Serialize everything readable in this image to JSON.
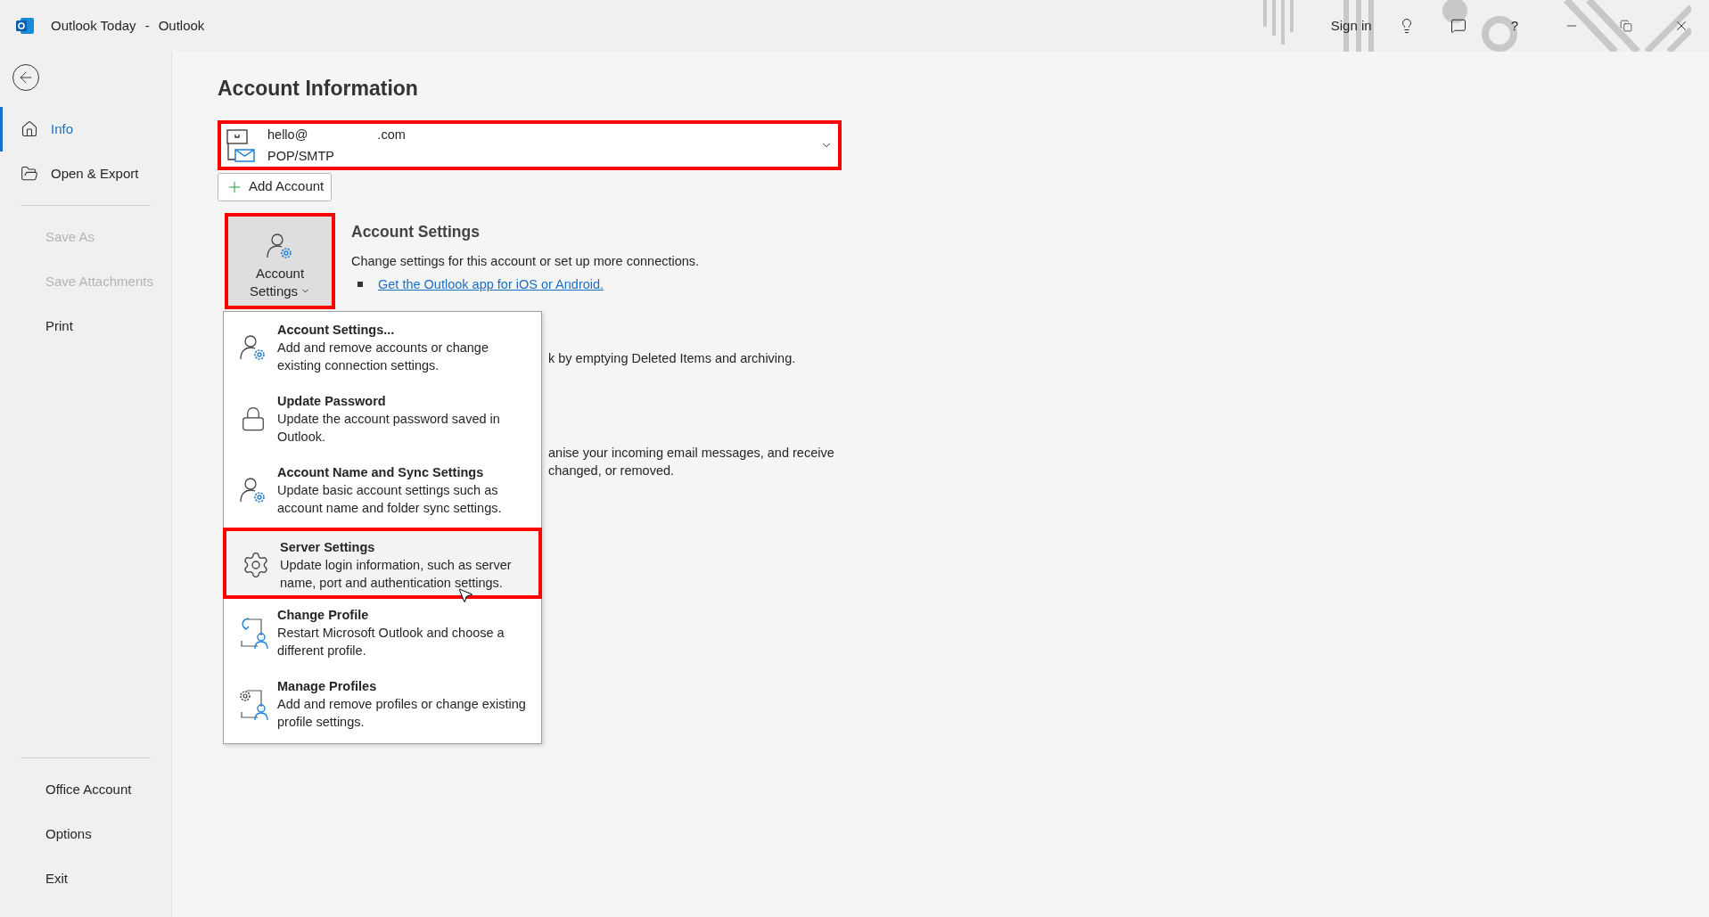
{
  "window": {
    "title": "Outlook Today",
    "separator": "-",
    "app": "Outlook",
    "sign_in": "Sign in",
    "help": "?"
  },
  "sidebar": {
    "top_items": [
      {
        "label": "Info",
        "selected": true
      },
      {
        "label": "Open & Export",
        "selected": false
      }
    ],
    "middle_items": [
      {
        "label": "Save As",
        "disabled": true
      },
      {
        "label": "Save Attachments",
        "disabled": true
      },
      {
        "label": "Print",
        "disabled": false
      }
    ],
    "bottom_items": [
      {
        "label": "Office Account"
      },
      {
        "label": "Options"
      },
      {
        "label": "Exit"
      }
    ]
  },
  "main": {
    "heading": "Account Information",
    "account": {
      "email_start": "hello@",
      "email_end": ".com",
      "type": "POP/SMTP",
      "highlighted": true
    },
    "add_account": "Add Account",
    "account_settings_button": {
      "line1": "Account",
      "line2": "Settings",
      "highlighted": true
    },
    "account_settings_section": {
      "title": "Account Settings",
      "description": "Change settings for this account or set up more connections.",
      "link": "Get the Outlook app for iOS or Android."
    },
    "covered_texts": [
      {
        "lines": [
          "k by emptying Deleted Items and archiving."
        ]
      },
      {
        "lines": [
          "anise your incoming email messages, and receive",
          "changed, or removed."
        ]
      }
    ]
  },
  "menu": {
    "items": [
      {
        "title": "Account Settings...",
        "description": "Add and remove accounts or change existing connection settings.",
        "highlighted": false
      },
      {
        "title": "Update Password",
        "description": "Update the account password saved in Outlook.",
        "highlighted": false
      },
      {
        "title": "Account Name and Sync Settings",
        "description": "Update basic account settings such as account name and folder sync settings.",
        "highlighted": false
      },
      {
        "title": "Server Settings",
        "description": "Update login information, such as server name, port and authentication settings.",
        "highlighted": true
      },
      {
        "title": "Change Profile",
        "description": "Restart Microsoft Outlook and choose a different profile.",
        "highlighted": false
      },
      {
        "title": "Manage Profiles",
        "description": "Add and remove profiles or change existing profile settings.",
        "highlighted": false
      }
    ]
  }
}
